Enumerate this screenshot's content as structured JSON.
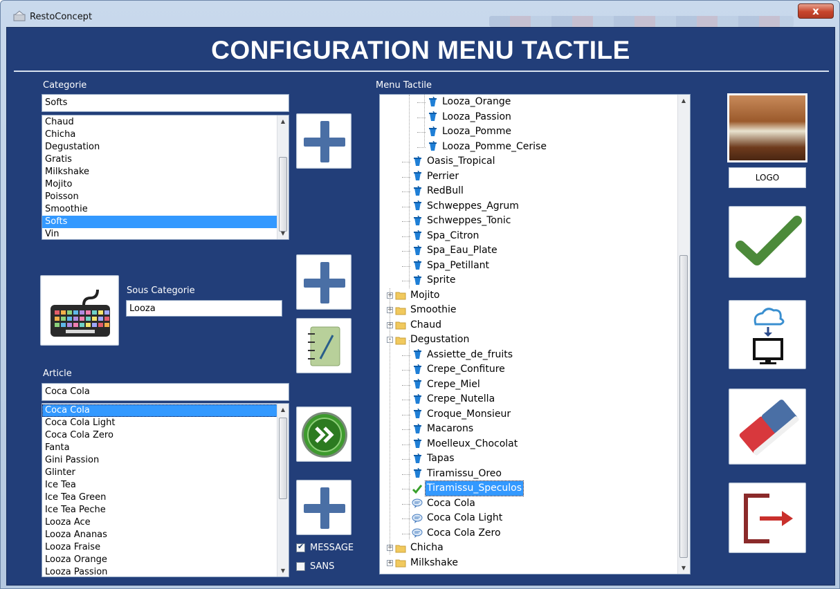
{
  "window": {
    "app_title": "RestoConcept",
    "close_label": "x"
  },
  "header": {
    "title": "CONFIGURATION MENU TACTILE"
  },
  "categorie": {
    "label": "Categorie",
    "value": "Softs",
    "items": [
      "Chaud",
      "Chicha",
      "Degustation",
      "Gratis",
      "Milkshake",
      "Mojito",
      "Poisson",
      "Smoothie",
      "Softs",
      "Vin"
    ],
    "selected": "Softs"
  },
  "sous_categorie": {
    "label": "Sous Categorie",
    "value": "Looza"
  },
  "article": {
    "label": "Article",
    "value": "Coca Cola",
    "items": [
      "Coca Cola",
      "Coca Cola Light",
      "Coca Cola Zero",
      "Fanta",
      "Gini Passion",
      "Glinter",
      "Ice Tea",
      "Ice Tea Green",
      "Ice Tea Peche",
      "Looza Ace",
      "Looza Ananas",
      "Looza Fraise",
      "Looza Orange",
      "Looza Passion"
    ],
    "selected": "Coca Cola"
  },
  "checkboxes": {
    "message": {
      "label": "MESSAGE",
      "checked": true
    },
    "sans": {
      "label": "SANS",
      "checked": false
    }
  },
  "menu_tactile": {
    "label": "Menu Tactile",
    "rows": [
      {
        "text": "Looza_Orange",
        "icon": "cup-icon",
        "level": 3
      },
      {
        "text": "Looza_Passion",
        "icon": "cup-icon",
        "level": 3
      },
      {
        "text": "Looza_Pomme",
        "icon": "cup-icon",
        "level": 3
      },
      {
        "text": "Looza_Pomme_Cerise",
        "icon": "cup-icon",
        "level": 3
      },
      {
        "text": "Oasis_Tropical",
        "icon": "cup-icon",
        "level": 2
      },
      {
        "text": "Perrier",
        "icon": "cup-icon",
        "level": 2
      },
      {
        "text": "RedBull",
        "icon": "cup-icon",
        "level": 2
      },
      {
        "text": "Schweppes_Agrum",
        "icon": "cup-icon",
        "level": 2
      },
      {
        "text": "Schweppes_Tonic",
        "icon": "cup-icon",
        "level": 2
      },
      {
        "text": "Spa_Citron",
        "icon": "cup-icon",
        "level": 2
      },
      {
        "text": "Spa_Eau_Plate",
        "icon": "cup-icon",
        "level": 2
      },
      {
        "text": "Spa_Petillant",
        "icon": "cup-icon",
        "level": 2
      },
      {
        "text": "Sprite",
        "icon": "cup-icon",
        "level": 2
      },
      {
        "text": "Mojito",
        "icon": "folder-icon",
        "level": 1,
        "expander": "+"
      },
      {
        "text": "Smoothie",
        "icon": "folder-icon",
        "level": 1,
        "expander": "+"
      },
      {
        "text": "Chaud",
        "icon": "folder-icon",
        "level": 1,
        "expander": "+"
      },
      {
        "text": "Degustation",
        "icon": "folder-icon",
        "level": 1,
        "expander": "-"
      },
      {
        "text": "Assiette_de_fruits",
        "icon": "cup-icon",
        "level": 2
      },
      {
        "text": "Crepe_Confiture",
        "icon": "cup-icon",
        "level": 2
      },
      {
        "text": "Crepe_Miel",
        "icon": "cup-icon",
        "level": 2
      },
      {
        "text": "Crepe_Nutella",
        "icon": "cup-icon",
        "level": 2
      },
      {
        "text": "Croque_Monsieur",
        "icon": "cup-icon",
        "level": 2
      },
      {
        "text": "Macarons",
        "icon": "cup-icon",
        "level": 2
      },
      {
        "text": "Moelleux_Chocolat",
        "icon": "cup-icon",
        "level": 2
      },
      {
        "text": "Tapas",
        "icon": "cup-icon",
        "level": 2
      },
      {
        "text": "Tiramissu_Oreo",
        "icon": "cup-icon",
        "level": 2
      },
      {
        "text": "Tiramissu_Speculos",
        "icon": "check-icon",
        "level": 2,
        "selected": true
      },
      {
        "text": "Coca Cola",
        "icon": "message-icon",
        "level": 2
      },
      {
        "text": "Coca Cola Light",
        "icon": "message-icon",
        "level": 2
      },
      {
        "text": "Coca Cola Zero",
        "icon": "message-icon",
        "level": 2
      },
      {
        "text": "Chicha",
        "icon": "folder-icon",
        "level": 1,
        "expander": "+"
      },
      {
        "text": "Milkshake",
        "icon": "folder-icon",
        "level": 1,
        "expander": "+"
      }
    ]
  },
  "logo": {
    "label": "LOGO"
  },
  "colors": {
    "background": "#223e79",
    "accent_blue": "#4a6fa5",
    "selection": "#3399ff",
    "check_green": "#4c8a3a",
    "eraser_red": "#d8383d",
    "exit_red": "#8b2a2a"
  }
}
